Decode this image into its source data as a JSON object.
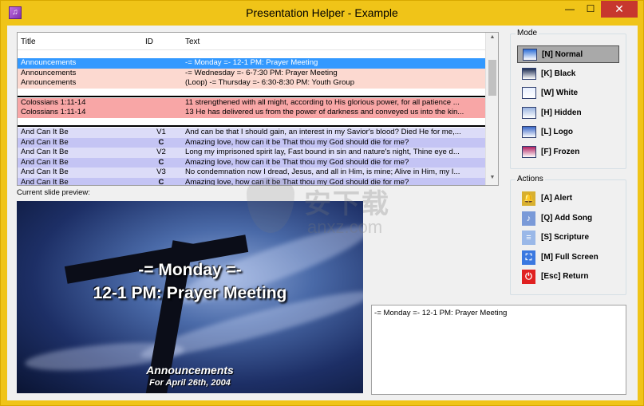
{
  "window": {
    "title": "Presentation Helper - Example",
    "minimize": "—",
    "maximize": "☐",
    "close": "✕"
  },
  "list": {
    "headers": {
      "title": "Title",
      "id": "ID",
      "text": "Text"
    },
    "groups": [
      [
        {
          "title": "Announcements",
          "id": "",
          "text": "-= Monday =- 12-1 PM: Prayer Meeting",
          "bg": "#3399ff",
          "fg": "#ffffff"
        },
        {
          "title": "Announcements",
          "id": "",
          "text": "-= Wednesday =- 6-7:30 PM: Prayer Meeting",
          "bg": "#fcd9d0",
          "fg": "#000000"
        },
        {
          "title": "Announcements",
          "id": "",
          "text": "(Loop) -= Thursday =- 6:30-8:30 PM: Youth Group",
          "bg": "#fcd9d0",
          "fg": "#000000"
        }
      ],
      [
        {
          "title": "Colossians 1:11-14",
          "id": "",
          "text": "11 strengthened with all might, according to His glorious power, for all patience ...",
          "bg": "#f8a6a6",
          "fg": "#000000"
        },
        {
          "title": "Colossians 1:11-14",
          "id": "",
          "text": "13 He has delivered us from the power of darkness and conveyed us into the kin...",
          "bg": "#f8a6a6",
          "fg": "#000000"
        }
      ],
      [
        {
          "title": "And Can It Be",
          "id": "V1",
          "text": "And can be that I should gain, an interest in my Savior's blood? Died He for me,...",
          "bg": "#dcdcf8",
          "fg": "#000000"
        },
        {
          "title": "And Can It Be",
          "id": "C",
          "text": "Amazing love, how can it be That thou my God should die for me?",
          "bg": "#c4c4f4",
          "fg": "#000000",
          "bold": true
        },
        {
          "title": "And Can It Be",
          "id": "V2",
          "text": "Long my imprisoned spirit lay, Fast bound in sin and nature's night, Thine eye d...",
          "bg": "#dcdcf8",
          "fg": "#000000"
        },
        {
          "title": "And Can It Be",
          "id": "C",
          "text": "Amazing love, how can it be That thou my God should die for me?",
          "bg": "#c4c4f4",
          "fg": "#000000",
          "bold": true
        },
        {
          "title": "And Can It Be",
          "id": "V3",
          "text": "No condemnation now I dread, Jesus, and all in Him, is mine; Alive in Him, my I...",
          "bg": "#dcdcf8",
          "fg": "#000000"
        },
        {
          "title": "And Can It Be",
          "id": "C",
          "text": "Amazing love, how can it be That thou my God should die for me?",
          "bg": "#c4c4f4",
          "fg": "#000000",
          "bold": true
        }
      ]
    ]
  },
  "preview": {
    "label": "Current slide preview:",
    "line1": "-= Monday =-",
    "line2": "12-1 PM: Prayer Meeting",
    "footer1": "Announcements",
    "footer2": "For April 26th, 2004"
  },
  "current_text": "-= Monday =- 12-1 PM: Prayer Meeting",
  "mode": {
    "title": "Mode",
    "buttons": [
      {
        "label": "[N] Normal",
        "icon": "monitor-normal-icon",
        "color": "#2e6fd8",
        "active": true
      },
      {
        "label": "[K] Black",
        "icon": "monitor-black-icon",
        "color": "#1a2a50",
        "active": false
      },
      {
        "label": "[W] White",
        "icon": "monitor-white-icon",
        "color": "#e8f0ff",
        "active": false
      },
      {
        "label": "[H] Hidden",
        "icon": "monitor-hidden-icon",
        "color": "#9ab4e0",
        "active": false
      },
      {
        "label": "[L] Logo",
        "icon": "monitor-logo-icon",
        "color": "#3a68c8",
        "active": false
      },
      {
        "label": "[F] Frozen",
        "icon": "monitor-frozen-icon",
        "color": "#b02060",
        "active": false
      }
    ]
  },
  "actions": {
    "title": "Actions",
    "buttons": [
      {
        "label": "[A] Alert",
        "icon": "alert-bell-icon",
        "color": "#d8b030"
      },
      {
        "label": "[Q] Add Song",
        "icon": "add-song-icon",
        "color": "#7a9ad8"
      },
      {
        "label": "[S] Scripture",
        "icon": "scripture-icon",
        "color": "#9ab8e8"
      },
      {
        "label": "[M] Full Screen",
        "icon": "full-screen-icon",
        "color": "#3a78e0"
      },
      {
        "label": "[Esc] Return",
        "icon": "return-icon",
        "color": "#e02020"
      }
    ]
  },
  "watermark": {
    "text": "安下载",
    "sub": "anxz.com"
  }
}
